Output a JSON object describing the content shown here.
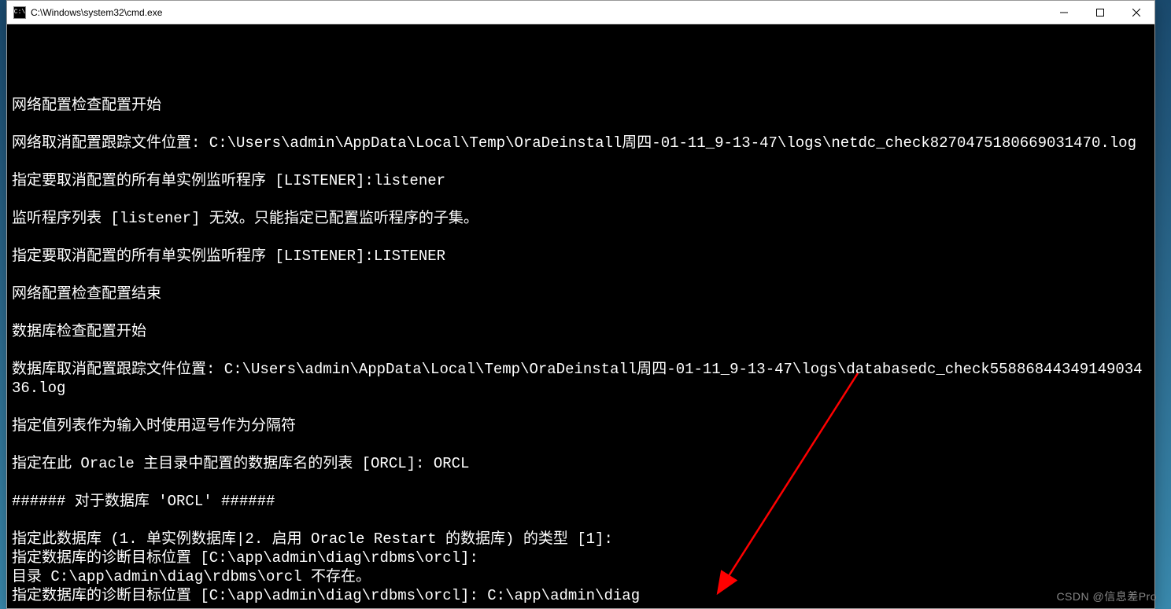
{
  "window": {
    "title": "C:\\Windows\\system32\\cmd.exe",
    "icon_label": "C:\\"
  },
  "terminal": {
    "lines": [
      "",
      "",
      "网络配置检查配置开始",
      "",
      "网络取消配置跟踪文件位置: C:\\Users\\admin\\AppData\\Local\\Temp\\OraDeinstall周四-01-11_9-13-47\\logs\\netdc_check8270475180669031470.log",
      "",
      "指定要取消配置的所有单实例监听程序 [LISTENER]:listener",
      "",
      "监听程序列表 [listener] 无效。只能指定已配置监听程序的子集。",
      "",
      "指定要取消配置的所有单实例监听程序 [LISTENER]:LISTENER",
      "",
      "网络配置检查配置结束",
      "",
      "数据库检查配置开始",
      "",
      "数据库取消配置跟踪文件位置: C:\\Users\\admin\\AppData\\Local\\Temp\\OraDeinstall周四-01-11_9-13-47\\logs\\databasedc_check5588684434914903436.log",
      "",
      "指定值列表作为输入时使用逗号作为分隔符",
      "",
      "指定在此 Oracle 主目录中配置的数据库名的列表 [ORCL]: ORCL",
      "",
      "###### 对于数据库 'ORCL' ######",
      "",
      "指定此数据库 (1. 单实例数据库|2. 启用 Oracle Restart 的数据库) 的类型 [1]:",
      "指定数据库的诊断目标位置 [C:\\app\\admin\\diag\\rdbms\\orcl]:",
      "目录 C:\\app\\admin\\diag\\rdbms\\orcl 不存在。",
      "指定数据库的诊断目标位置 [C:\\app\\admin\\diag\\rdbms\\orcl]: C:\\app\\admin\\diag"
    ]
  },
  "watermark": "CSDN @信息差Pro",
  "annotation": {
    "color": "#ff0000"
  }
}
